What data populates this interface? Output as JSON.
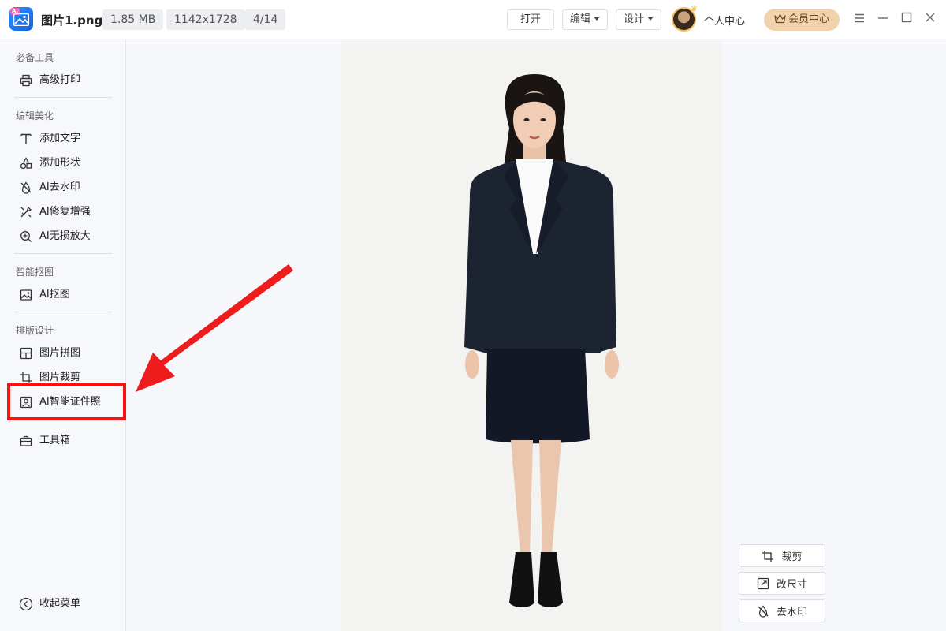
{
  "titlebar": {
    "filename": "图片1.png",
    "filesize": "1.85 MB",
    "dimensions": "1142x1728",
    "page_index": "4/14",
    "open_label": "打开",
    "edit_label": "编辑",
    "design_label": "设计",
    "profile_label": "个人中心",
    "vip_label": "会员中心"
  },
  "sidebar": {
    "sections": [
      {
        "title": "必备工具",
        "items": [
          {
            "label": "高级打印",
            "icon": "printer-icon"
          }
        ]
      },
      {
        "title": "编辑美化",
        "items": [
          {
            "label": "添加文字",
            "icon": "text-icon"
          },
          {
            "label": "添加形状",
            "icon": "shapes-icon"
          },
          {
            "label": "AI去水印",
            "icon": "watermark-remove-icon"
          },
          {
            "label": "AI修复增强",
            "icon": "repair-enhance-icon"
          },
          {
            "label": "AI无损放大",
            "icon": "zoom-in-icon"
          }
        ]
      },
      {
        "title": "智能抠图",
        "items": [
          {
            "label": "AI抠图",
            "icon": "image-cutout-icon"
          }
        ]
      },
      {
        "title": "排版设计",
        "items": [
          {
            "label": "图片拼图",
            "icon": "collage-icon"
          },
          {
            "label": "图片裁剪",
            "icon": "crop-icon"
          },
          {
            "label": "AI智能证件照",
            "icon": "id-photo-icon"
          }
        ]
      }
    ],
    "toolbox_label": "工具箱",
    "collapse_label": "收起菜单"
  },
  "canvas": {
    "tools": [
      {
        "label": "裁剪",
        "icon": "crop-icon"
      },
      {
        "label": "改尺寸",
        "icon": "resize-icon"
      },
      {
        "label": "去水印",
        "icon": "watermark-remove-icon"
      }
    ]
  },
  "colors": {
    "accent": "#1a6fe8",
    "highlight_box": "#ff1010",
    "vip_bg": "#f1d2ac",
    "suit": "#1c2331"
  }
}
